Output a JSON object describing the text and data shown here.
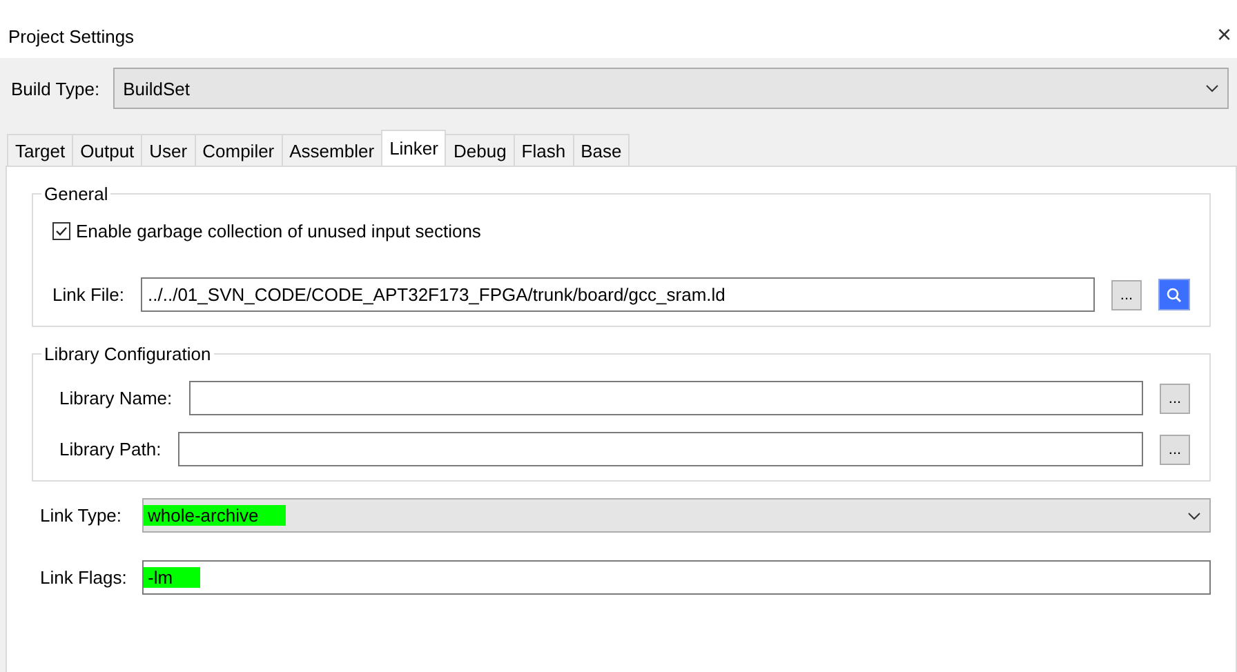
{
  "window": {
    "title": "Project Settings",
    "close": "×"
  },
  "build_type": {
    "label": "Build Type:",
    "value": "BuildSet"
  },
  "tabs": [
    {
      "label": "Target",
      "selected": false
    },
    {
      "label": "Output",
      "selected": false
    },
    {
      "label": "User",
      "selected": false
    },
    {
      "label": "Compiler",
      "selected": false
    },
    {
      "label": "Assembler",
      "selected": false
    },
    {
      "label": "Linker",
      "selected": true
    },
    {
      "label": "Debug",
      "selected": false
    },
    {
      "label": "Flash",
      "selected": false
    },
    {
      "label": "Base",
      "selected": false
    }
  ],
  "general": {
    "title": "General",
    "gc_checkbox": {
      "label": "Enable garbage collection of unused input sections",
      "checked": true
    },
    "link_file": {
      "label": "Link File:",
      "value": "../../01_SVN_CODE/CODE_APT32F173_FPGA/trunk/board/gcc_sram.ld",
      "browse": "..."
    }
  },
  "library": {
    "title": "Library Configuration",
    "fields": [
      {
        "label": "Library Name:",
        "browse": "..."
      },
      {
        "label": "Library Path:",
        "browse": "..."
      }
    ]
  },
  "link_type": {
    "label": "Link Type:",
    "value": "whole-archive",
    "highlighted": true
  },
  "link_flags": {
    "label": "Link Flags:",
    "value": "-lm",
    "highlighted": true
  }
}
